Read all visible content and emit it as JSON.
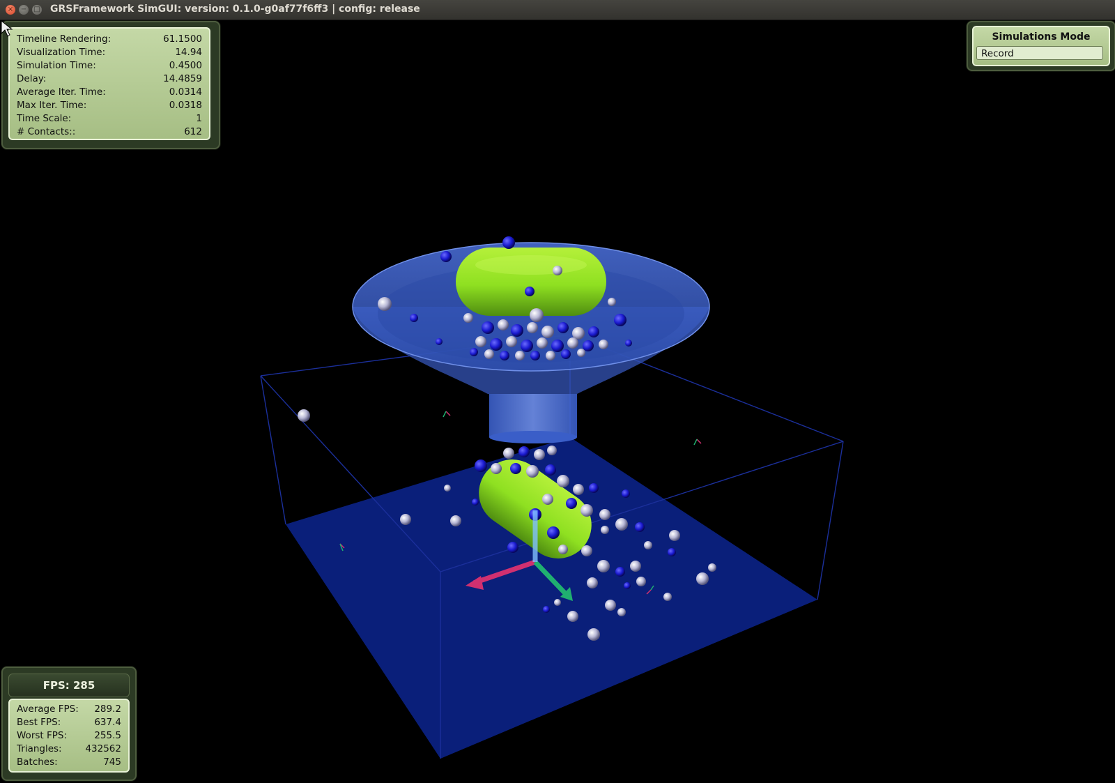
{
  "window": {
    "title": "GRSFramework SimGUI: version: 0.1.0-g0af77f6ff3 | config: release",
    "close_glyph": "×",
    "minimize_glyph": "−",
    "maximize_glyph": "□"
  },
  "stats_panel": {
    "rows": [
      {
        "label": "Timeline Rendering:",
        "value": "61.1500"
      },
      {
        "label": "Visualization Time:",
        "value": "14.94"
      },
      {
        "label": "Simulation Time:",
        "value": "0.4500"
      },
      {
        "label": "Delay:",
        "value": "14.4859"
      },
      {
        "label": "Average Iter. Time:",
        "value": "0.0314"
      },
      {
        "label": "Max Iter. Time:",
        "value": "0.0318"
      },
      {
        "label": "Time Scale:",
        "value": "1"
      },
      {
        "label": "# Contacts::",
        "value": "612"
      }
    ]
  },
  "simulation_mode": {
    "heading": "Simulations Mode",
    "selected": "Record"
  },
  "fps_panel": {
    "heading": "FPS: 285",
    "rows": [
      {
        "label": "Average FPS:",
        "value": "289.2"
      },
      {
        "label": "Best FPS:",
        "value": "637.4"
      },
      {
        "label": "Worst FPS:",
        "value": "255.5"
      },
      {
        "label": "Triangles:",
        "value": "432562"
      },
      {
        "label": "Batches:",
        "value": "745"
      }
    ]
  },
  "scene": {
    "background": "#000000",
    "floor_color": "#0a1f7a",
    "box_edge_color": "#1b2f9a",
    "funnel_color": "#3a5fd0",
    "capsule_color": "#8fe021",
    "sphere_blue": "#1a1ad0",
    "sphere_white": "#c8c8e0",
    "axis_x_color": "#d03070",
    "axis_y_color": "#80c0ff",
    "axis_z_color": "#20b070"
  }
}
